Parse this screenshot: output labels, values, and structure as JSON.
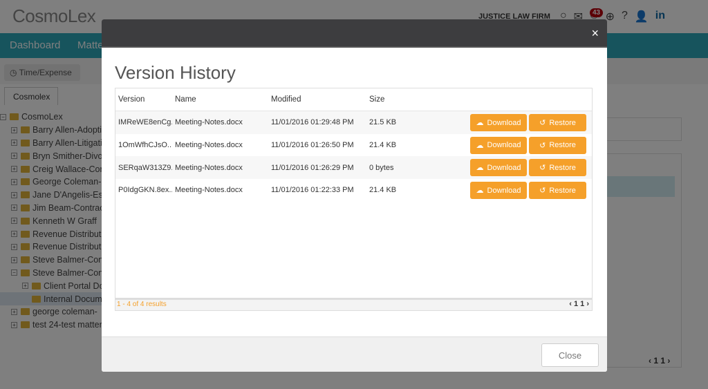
{
  "app": {
    "logo": "CosmoLex",
    "firm": "JUSTICE LAW FIRM",
    "notification_count": "43",
    "nav": [
      "Dashboard",
      "Matters"
    ],
    "time_expense": "Time/Expense",
    "tab": "Cosmolex",
    "pager": "‹ 1 1 ›"
  },
  "tree": {
    "root": "CosmoLex",
    "items": [
      "Barry Allen-Adoption",
      "Barry Allen-Litigation",
      "Bryn Smither-Divorce",
      "Creig Wallace-Contract",
      "George Coleman-",
      "Jane D'Angelis-Estate",
      "Jim Beam-Contract",
      "Kenneth W Graff",
      "Revenue Distribution",
      "Revenue Distribution",
      "Steve Balmer-Contract",
      "Steve Balmer-Contract"
    ],
    "children": [
      "Client Portal Documents",
      "Internal Documents"
    ],
    "after": [
      "george coleman-",
      "test 24-test matter"
    ]
  },
  "modal": {
    "title": "Version History",
    "close_label": "Close",
    "close_icon": "×",
    "columns": [
      "Version",
      "Name",
      "Modified",
      "Size"
    ],
    "rows": [
      {
        "version": "IMReWE8enCg...",
        "name": "Meeting-Notes.docx",
        "modified": "11/01/2016 01:29:48 PM",
        "size": "21.5 KB"
      },
      {
        "version": "1OmWfhCJsO...",
        "name": "Meeting-Notes.docx",
        "modified": "11/01/2016 01:26:50 PM",
        "size": "21.4 KB"
      },
      {
        "version": "SERqaW313Z9...",
        "name": "Meeting-Notes.docx",
        "modified": "11/01/2016 01:26:29 PM",
        "size": "0 bytes"
      },
      {
        "version": "P0IdgGKN.8ex...",
        "name": "Meeting-Notes.docx",
        "modified": "11/01/2016 01:22:33 PM",
        "size": "21.4 KB"
      }
    ],
    "download_label": "Download",
    "restore_label": "Restore",
    "results": "1 - 4 of 4 results",
    "pager": "‹ 1 1 ›"
  },
  "colors": {
    "accent": "#f5a02a",
    "nav": "#2fa8bb",
    "modal_header": "#3d3d3f"
  }
}
